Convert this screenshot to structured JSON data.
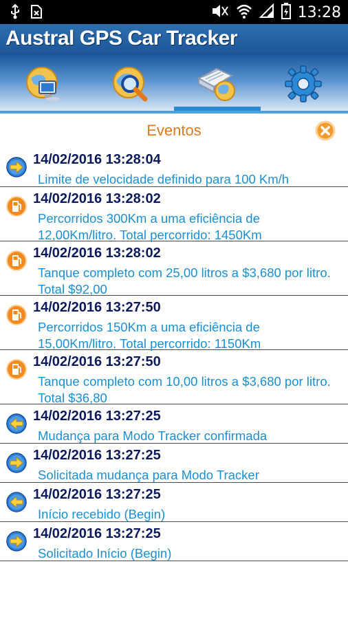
{
  "status_bar": {
    "time": "13:28",
    "icons": [
      "usb-icon",
      "no-sim-icon",
      "mute-icon",
      "wifi-icon",
      "signal-icon",
      "battery-icon"
    ]
  },
  "app": {
    "title": "Austral GPS Car Tracker"
  },
  "toolbar": {
    "tools": [
      {
        "name": "monitor-globe-icon"
      },
      {
        "name": "search-globe-icon"
      },
      {
        "name": "events-globe-icon",
        "active": true
      },
      {
        "name": "settings-gear-icon"
      }
    ]
  },
  "events": {
    "title": "Eventos",
    "close_icon": "close-icon",
    "items": [
      {
        "time": "14/02/2016 13:28:04",
        "message": "Limite de velocidade definido para 100 Km/h",
        "icon": "arrow-right-icon"
      },
      {
        "time": "14/02/2016 13:28:02",
        "message": "Percorridos 300Km a uma eficiência de 12,00Km/litro. Total percorrido: 1450Km",
        "icon": "fuel-icon"
      },
      {
        "time": "14/02/2016 13:28:02",
        "message": "Tanque completo com 25,00 litros a $3,680 por litro. Total $92,00",
        "icon": "fuel-icon"
      },
      {
        "time": "14/02/2016 13:27:50",
        "message": "Percorridos 150Km a uma eficiência de 15,00Km/litro. Total percorrido: 1150Km",
        "icon": "fuel-icon"
      },
      {
        "time": "14/02/2016 13:27:50",
        "message": "Tanque completo com 10,00 litros a $3,680 por litro. Total $36,80",
        "icon": "fuel-icon"
      },
      {
        "time": "14/02/2016 13:27:25",
        "message": "Mudança para Modo Tracker confirmada",
        "icon": "arrow-left-icon"
      },
      {
        "time": "14/02/2016 13:27:25",
        "message": "Solicitada mudança para Modo Tracker",
        "icon": "arrow-right-icon"
      },
      {
        "time": "14/02/2016 13:27:25",
        "message": "Início recebido (Begin)",
        "icon": "arrow-left-icon"
      },
      {
        "time": "14/02/2016 13:27:25",
        "message": "Solicitado Início (Begin)",
        "icon": "arrow-right-icon"
      }
    ]
  }
}
